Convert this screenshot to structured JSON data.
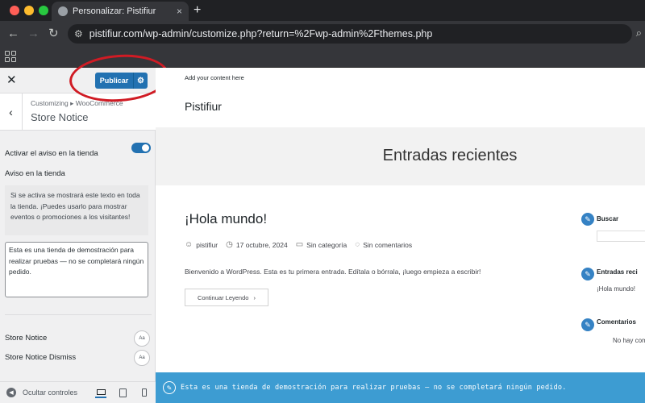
{
  "browser": {
    "tab_title": "Personalizar: Pistifiur",
    "tab_close": "×",
    "new_tab": "+",
    "back": "←",
    "forward": "→",
    "reload": "↻",
    "url": "pistifiur.com/wp-admin/customize.php?return=%2Fwp-admin%2Fthemes.php",
    "traffic_colors": [
      "#ff5f57",
      "#febc2e",
      "#28c840"
    ]
  },
  "customizer": {
    "close": "✕",
    "publish_label": "Publicar",
    "publish_gear": "⚙",
    "back_arrow": "‹",
    "breadcrumb": "Customizing ▸ WooCommerce",
    "section_title": "Store Notice",
    "toggle_label": "Activar el aviso en la tienda",
    "toggle_state": true,
    "notice_label": "Aviso en la tienda",
    "notice_description": "Si se activa se mostrará este texto en toda la tienda. ¡Puedes usarlo para mostrar eventos o promociones a los visitantes!",
    "notice_text": "Esta es una tienda de demostración para realizar pruebas — no se completará ningún pedido.",
    "font_controls": [
      {
        "label": "Store Notice",
        "button": "Aa"
      },
      {
        "label": "Store Notice Dismiss",
        "button": "Aa"
      }
    ],
    "hide_controls": "Ocultar controles",
    "accent_color": "#2271b1"
  },
  "preview": {
    "tagline": "Add your content here",
    "site_title": "Pistifiur",
    "hero_title": "Entradas recientes",
    "post": {
      "title": "¡Hola mundo!",
      "author": "pistifiur",
      "date": "17 octubre, 2024",
      "category": "Sin categoría",
      "comments": "Sin comentarios",
      "excerpt": "Bienvenido a WordPress. Esta es tu primera entrada. Edítala o bórrala, ¡luego empieza a escribir!",
      "read_more": "Continuar Leyendo",
      "read_more_arrow": "›"
    },
    "widgets": {
      "search_title": "Buscar",
      "recent_title": "Entradas reci",
      "recent_item": "¡Hola mundo!",
      "comments_title": "Comentarios",
      "comments_item": "No hay com"
    },
    "store_notice": "Esta es una tienda de demostración para realizar pruebas — no se completará ningún pedido.",
    "store_notice_color": "#3d9cd2"
  }
}
